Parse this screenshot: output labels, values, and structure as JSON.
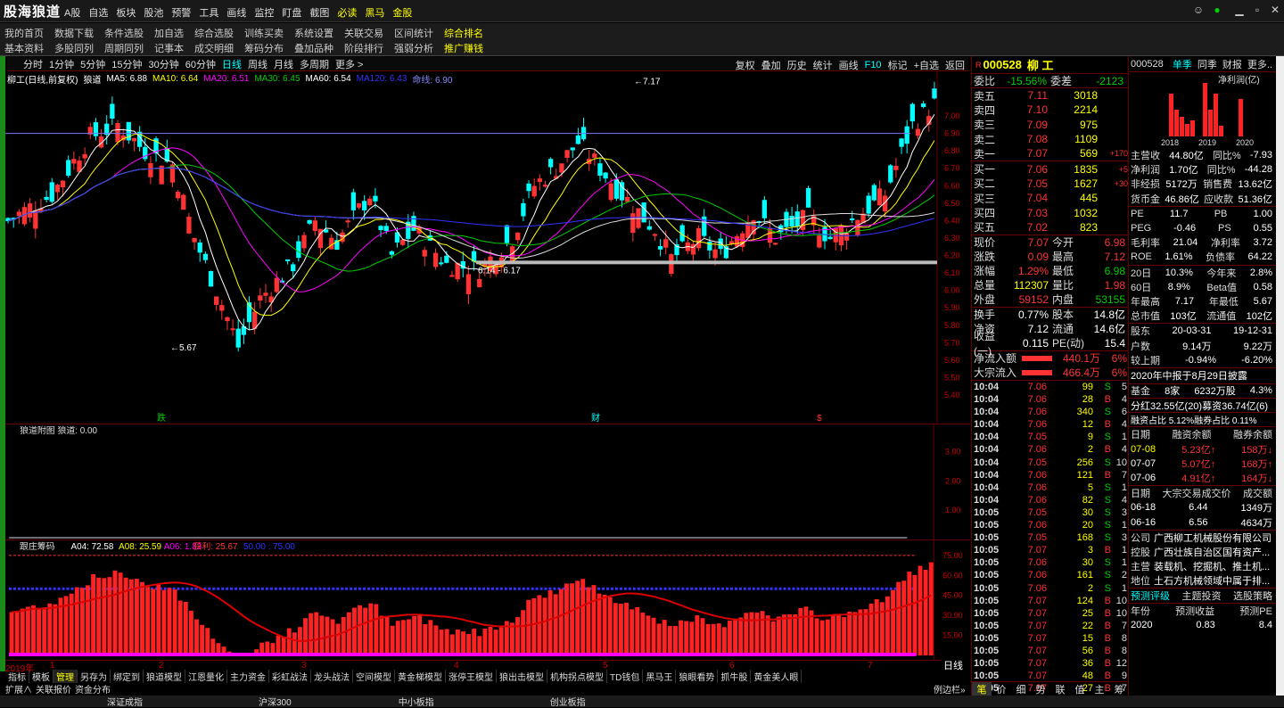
{
  "app": {
    "logo": "股海狼道"
  },
  "top_menu": [
    "A股",
    "自选",
    "板块",
    "股池",
    "预警",
    "工具",
    "画线",
    "监控",
    "盯盘",
    "截图",
    "必读",
    "黑马",
    "金股"
  ],
  "menu_row1": [
    "我的首页",
    "数据下载",
    "条件选股",
    "加自选",
    "综合选股",
    "训练买卖",
    "系统设置",
    "关联交易",
    "区间统计",
    "综合排名"
  ],
  "menu_row2": [
    "基本资料",
    "多股同列",
    "周期同列",
    "记事本",
    "成交明细",
    "筹码分布",
    "叠加品种",
    "阶段排行",
    "强弱分析",
    "推广赚钱"
  ],
  "period_tabs": [
    "分时",
    "1分钟",
    "5分钟",
    "15分钟",
    "30分钟",
    "60分钟",
    "日线",
    "周线",
    "月线",
    "多周期",
    "更多 >"
  ],
  "active_period": "日线",
  "chart_tools": [
    "复权",
    "叠加",
    "历史",
    "统计",
    "画线",
    "F10",
    "标记",
    "+自选",
    "返回"
  ],
  "chart_info": {
    "name": "柳工(日线,前复权)",
    "indicator": "狼道",
    "ma5": "MA5: 6.88",
    "ma10": "MA10: 6.64",
    "ma20": "MA20: 6.51",
    "ma30": "MA30: 6.45",
    "ma60": "MA60: 6.54",
    "ma120": "MA120: 6.43",
    "life": "命线: 6.90"
  },
  "sub_info": {
    "label": "狼道附图 狼道: 0.00"
  },
  "chip_info": {
    "label": "跟庄筹码",
    "a04": "A04: 72.58",
    "a08": "A08: 25.59",
    "a06": "A06: 1.83",
    "profit": "获利: 25.67",
    "blue": "50.00 : 75.00"
  },
  "price_axis": [
    "7.00",
    "6.90",
    "6.80",
    "6.70",
    "6.60",
    "6.50",
    "6.40",
    "6.30",
    "6.20",
    "6.10",
    "6.00",
    "5.90",
    "5.80",
    "5.70",
    "5.60",
    "5.50",
    "5.40"
  ],
  "sub_axis": [
    "3.00",
    "2.00",
    "1.00"
  ],
  "chip_axis": [
    "75.00",
    "60.00",
    "45.00",
    "30.00",
    "15.00"
  ],
  "annotations": {
    "high": "7.17",
    "low": "5.67",
    "range": "6.14 - 6.17",
    "m1": "跌",
    "m2": "财",
    "m3": "$"
  },
  "date_axis": [
    "2019年",
    "1",
    "2",
    "3",
    "4",
    "5",
    "6",
    "7"
  ],
  "axis_mode": "日线",
  "bottom_tabs": [
    "指标",
    "模板",
    "管理",
    "另存为",
    "绑定到",
    "狼道模型",
    "江恩量化",
    "主力资金",
    "彩虹战法",
    "龙头战法",
    "空间模型",
    "黄金梯模型",
    "涨停王模型",
    "狼出击模型",
    "机构拐点模型",
    "TD钱包",
    "黑马王",
    "狼眼看势",
    "抓牛股",
    "黄金美人眼"
  ],
  "bottom_tab_on": "管理",
  "ex_tabs": [
    "扩展∧",
    "关联报价",
    "资金分布"
  ],
  "quote": {
    "code": "000528",
    "name": "柳 工",
    "r_badge": "R",
    "webi_label": "委比",
    "webi": "-15.56%",
    "wecha_label": "委差",
    "wecha": "-2123",
    "asks": [
      {
        "l": "卖五",
        "p": "7.11",
        "v": "3018",
        "d": ""
      },
      {
        "l": "卖四",
        "p": "7.10",
        "v": "2214",
        "d": ""
      },
      {
        "l": "卖三",
        "p": "7.09",
        "v": "975",
        "d": ""
      },
      {
        "l": "卖二",
        "p": "7.08",
        "v": "1109",
        "d": ""
      },
      {
        "l": "卖一",
        "p": "7.07",
        "v": "569",
        "d": "+170"
      }
    ],
    "bids": [
      {
        "l": "买一",
        "p": "7.06",
        "v": "1835",
        "d": "+5"
      },
      {
        "l": "买二",
        "p": "7.05",
        "v": "1627",
        "d": "+30"
      },
      {
        "l": "买三",
        "p": "7.04",
        "v": "445",
        "d": ""
      },
      {
        "l": "买四",
        "p": "7.03",
        "v": "1032",
        "d": ""
      },
      {
        "l": "买五",
        "p": "7.02",
        "v": "823",
        "d": ""
      }
    ],
    "stats": [
      [
        "现价",
        "7.07",
        "今开",
        "6.98"
      ],
      [
        "涨跌",
        "0.09",
        "最高",
        "7.12"
      ],
      [
        "涨幅",
        "1.29%",
        "最低",
        "6.98"
      ],
      [
        "总量",
        "112307",
        "量比",
        "1.98"
      ],
      [
        "外盘",
        "59152",
        "内盘",
        "53155"
      ]
    ],
    "stats2": [
      [
        "换手",
        "0.77%",
        "股本",
        "14.8亿"
      ],
      [
        "净资",
        "7.12",
        "流通",
        "14.6亿"
      ],
      [
        "收益(一)",
        "0.115",
        "PE(动)",
        "15.4"
      ]
    ],
    "flow": [
      [
        "净流入额",
        "440.1万",
        "6%"
      ],
      [
        "大宗流入",
        "466.4万",
        "6%"
      ]
    ],
    "ticks": [
      [
        "10:04",
        "7.06",
        "99",
        "S",
        "5"
      ],
      [
        "10:04",
        "7.06",
        "28",
        "B",
        "4"
      ],
      [
        "10:04",
        "7.06",
        "340",
        "S",
        "6"
      ],
      [
        "10:04",
        "7.06",
        "12",
        "B",
        "4"
      ],
      [
        "10:04",
        "7.05",
        "9",
        "S",
        "1"
      ],
      [
        "10:04",
        "7.06",
        "2",
        "B",
        "4"
      ],
      [
        "10:04",
        "7.05",
        "256",
        "S",
        "10"
      ],
      [
        "10:04",
        "7.06",
        "121",
        "B",
        "7"
      ],
      [
        "10:04",
        "7.06",
        "5",
        "S",
        "1"
      ],
      [
        "10:04",
        "7.06",
        "82",
        "S",
        "4"
      ],
      [
        "10:05",
        "7.05",
        "30",
        "S",
        "3"
      ],
      [
        "10:05",
        "7.06",
        "20",
        "S",
        "1"
      ],
      [
        "10:05",
        "7.05",
        "168",
        "S",
        "3"
      ],
      [
        "10:05",
        "7.07",
        "3",
        "B",
        "1"
      ],
      [
        "10:05",
        "7.06",
        "30",
        "S",
        "1"
      ],
      [
        "10:05",
        "7.06",
        "161",
        "S",
        "2"
      ],
      [
        "10:05",
        "7.06",
        "2",
        "S",
        "1"
      ],
      [
        "10:05",
        "7.07",
        "124",
        "B",
        "10"
      ],
      [
        "10:05",
        "7.07",
        "25",
        "B",
        "10"
      ],
      [
        "10:05",
        "7.07",
        "22",
        "B",
        "7"
      ],
      [
        "10:05",
        "7.07",
        "15",
        "B",
        "8"
      ],
      [
        "10:05",
        "7.07",
        "56",
        "B",
        "8"
      ],
      [
        "10:05",
        "7.07",
        "36",
        "B",
        "12"
      ],
      [
        "10:05",
        "7.07",
        "48",
        "B",
        "9"
      ],
      [
        "10:05",
        "7.07",
        "27",
        "B",
        "7"
      ]
    ],
    "tabs": [
      "笔",
      "价",
      "细",
      "势",
      "联",
      "值",
      "主",
      "筹"
    ],
    "left_label": "例边栏»"
  },
  "f10": {
    "code": "000528",
    "tabs": [
      "单季",
      "同季",
      "财报",
      "更多.."
    ],
    "chart_title": "净利润(亿)",
    "years": [
      "2018",
      "2019",
      "2020"
    ],
    "fin": [
      [
        "主营收",
        "44.80亿",
        "同比%",
        "-7.93"
      ],
      [
        "净利润",
        "1.70亿",
        "同比%",
        "-44.28"
      ],
      [
        "非经损",
        "5172万",
        "销售费",
        "13.62亿"
      ],
      [
        "货币金",
        "46.86亿",
        "应收款",
        "51.36亿"
      ]
    ],
    "val": [
      [
        "PE",
        "11.7",
        "PB",
        "1.00"
      ],
      [
        "PEG",
        "-0.46",
        "PS",
        "0.55"
      ],
      [
        "毛利率",
        "21.04",
        "净利率",
        "3.72"
      ],
      [
        "ROE",
        "1.61%",
        "负债率",
        "64.22"
      ]
    ],
    "perf": [
      [
        "20日",
        "10.3%",
        "今年来",
        "2.8%"
      ],
      [
        "60日",
        "8.9%",
        "Beta值",
        "0.58"
      ],
      [
        "年最高",
        "7.17",
        "年最低",
        "5.67"
      ],
      [
        "总市值",
        "103亿",
        "流通值",
        "102亿"
      ]
    ],
    "holders": [
      [
        "股东",
        "20-03-31",
        "19-12-31"
      ],
      [
        "户数",
        "9.14万",
        "9.22万"
      ],
      [
        "较上期",
        "-0.94%",
        "-6.20%"
      ]
    ],
    "report": "2020年中报于8月29日披露",
    "fund": [
      "基金",
      "8家",
      "6232万股",
      "4.3%"
    ],
    "div": "分红32.55亿(20)募资36.74亿(6)",
    "margin_ratio": "融资占比 5.12%融券占比 0.11%",
    "margin_head": [
      "日期",
      "融资余额",
      "融券余额"
    ],
    "margin": [
      [
        "07-08",
        "5.23亿↑",
        "158万↓"
      ],
      [
        "07-07",
        "5.07亿↑",
        "168万↑"
      ],
      [
        "07-06",
        "4.91亿↑",
        "164万↓"
      ]
    ],
    "block_head": [
      "日期",
      "大宗交易成交价",
      "成交额"
    ],
    "block": [
      [
        "06-18",
        "6.44",
        "1349万"
      ],
      [
        "06-16",
        "6.56",
        "4634万"
      ]
    ],
    "company": [
      [
        "公司",
        "广西柳工机械股份有限公司"
      ],
      [
        "控股",
        "广西壮族自治区国有资产..."
      ],
      [
        "主营",
        "装载机、挖掘机、推土机..."
      ],
      [
        "地位",
        "土石方机械领域中属于排..."
      ]
    ],
    "bottom_tabs": [
      "预测评级",
      "主题投资",
      "选股策略"
    ],
    "forecast_head": [
      "年份",
      "预测收益",
      "预测PE"
    ],
    "forecast": [
      [
        "2020",
        "0.83",
        "8.4"
      ]
    ]
  },
  "status": {
    "a": "深证成指",
    "b": "沪深300",
    "c": "中小板指",
    "d": "创业板指"
  }
}
